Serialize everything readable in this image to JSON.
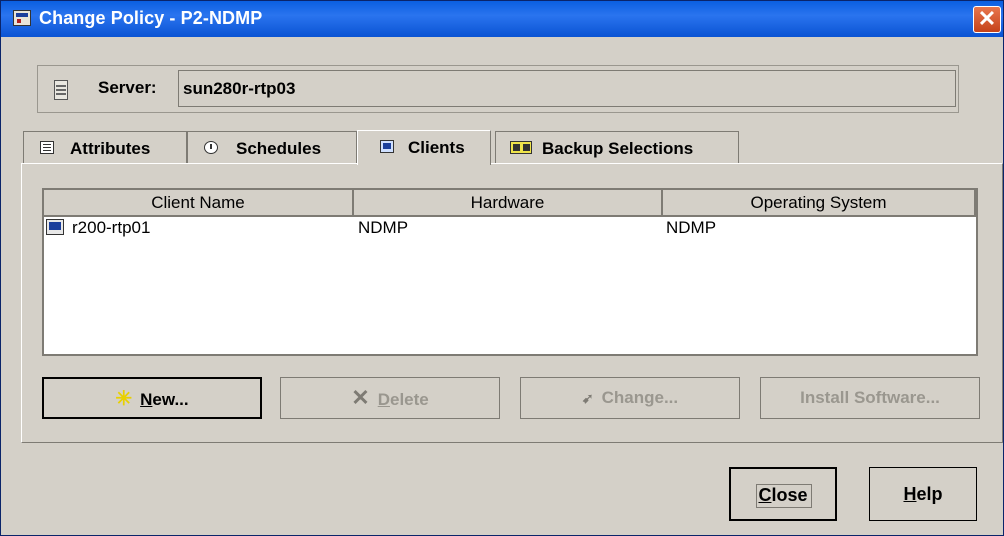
{
  "window": {
    "title": "Change Policy - P2-NDMP",
    "close_glyph": "✕"
  },
  "server": {
    "label": "Server:",
    "value": "sun280r-rtp03",
    "icon": "server-icon"
  },
  "tabs": [
    {
      "label": "Attributes",
      "icon": "attributes-icon",
      "active": false
    },
    {
      "label": "Schedules",
      "icon": "schedules-icon",
      "active": false
    },
    {
      "label": "Clients",
      "icon": "clients-icon",
      "active": true
    },
    {
      "label": "Backup Selections",
      "icon": "backup-selections-icon",
      "active": false
    }
  ],
  "table": {
    "columns": [
      "Client Name",
      "Hardware",
      "Operating System"
    ],
    "rows": [
      {
        "client_name": "r200-rtp01",
        "hardware": "NDMP",
        "operating_system": "NDMP",
        "icon": "computer-icon"
      }
    ]
  },
  "panel_buttons": {
    "new": {
      "label": "New...",
      "underline": "N",
      "rest": "ew...",
      "enabled": true
    },
    "delete": {
      "label": "Delete",
      "underline": "D",
      "rest": "elete",
      "enabled": false
    },
    "change": {
      "label": "Change...",
      "underline": "",
      "rest": "Change...",
      "enabled": false
    },
    "install": {
      "label": "Install Software...",
      "enabled": false
    }
  },
  "dialog_buttons": {
    "close": {
      "label": "Close",
      "underline": "C",
      "rest": "lose"
    },
    "help": {
      "label": "Help",
      "underline": "H",
      "rest": "elp"
    }
  },
  "colors": {
    "titlebar": "#0a53d3",
    "window_bg": "#d4d0c8",
    "disabled_text": "#9a978f"
  }
}
